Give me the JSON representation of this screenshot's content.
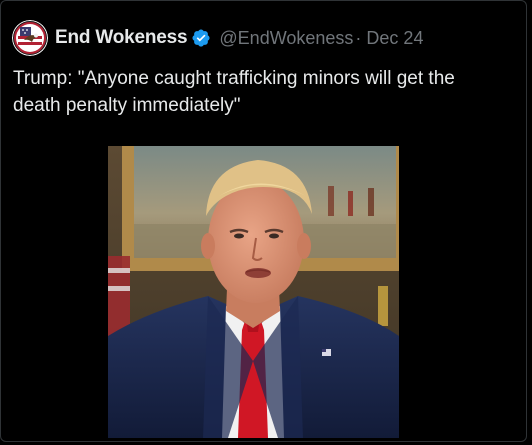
{
  "tweet": {
    "display_name": "End Wokeness",
    "handle": "@EndWokeness",
    "separator": "·",
    "date": "Dec 24",
    "text": "Trump: \"Anyone caught trafficking minors will get the death penalty immediately\"",
    "verified": true
  },
  "colors": {
    "background": "#000000",
    "text": "#e7e9ea",
    "secondary_text": "#71767b",
    "verified_blue": "#1d9bf0",
    "border": "#2f3336"
  },
  "icons": {
    "avatar": "eagle-flag-avatar-icon",
    "verified": "verified-badge-icon"
  },
  "media": {
    "type": "video-thumbnail"
  }
}
